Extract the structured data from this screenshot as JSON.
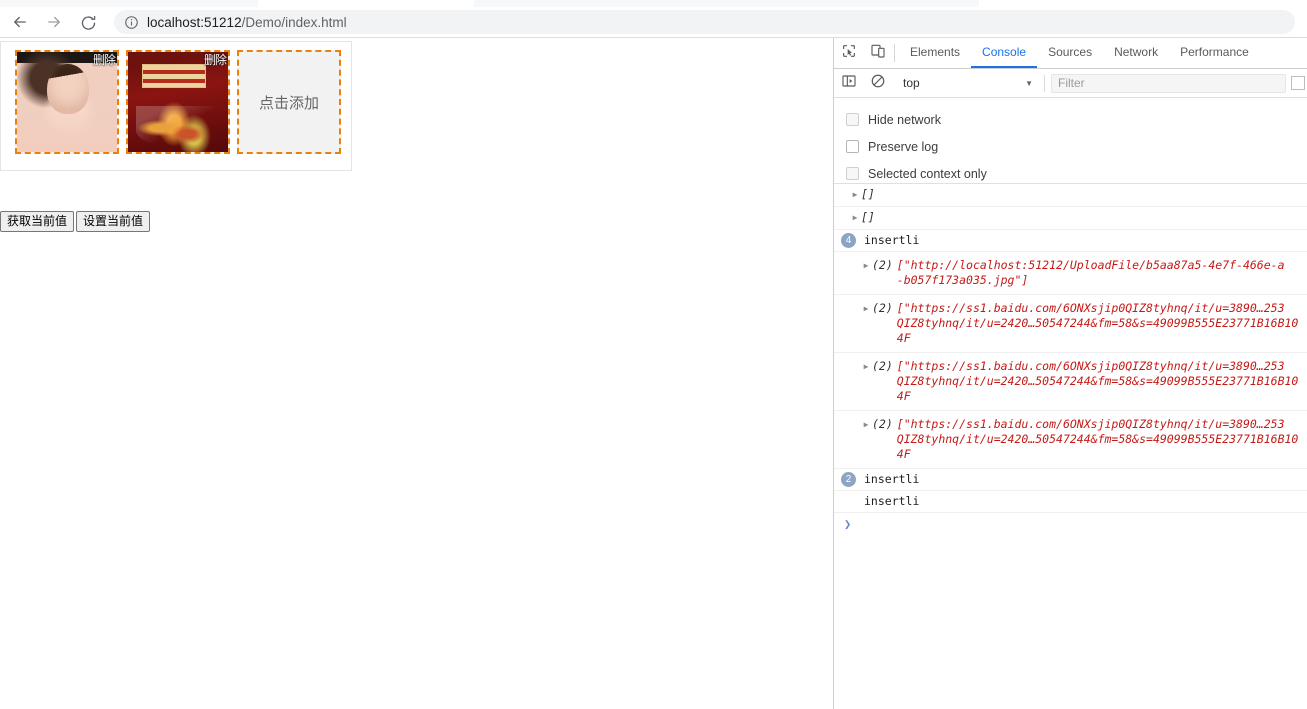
{
  "browser": {
    "back_icon": "back-arrow-icon",
    "forward_icon": "forward-arrow-icon",
    "reload_icon": "reload-icon",
    "info_icon": "info-circle-icon",
    "url_host": "localhost:51212",
    "url_path": "/Demo/index.html",
    "url_full": "localhost:51212/Demo/index.html"
  },
  "page": {
    "thumbnails": [
      {
        "alt": "portrait-photo",
        "delete_label": "删除"
      },
      {
        "alt": "food-poster-photo",
        "delete_label": "删除"
      }
    ],
    "add_label": "点击添加",
    "buttons": [
      {
        "label": "获取当前值"
      },
      {
        "label": "设置当前值"
      }
    ]
  },
  "devtools": {
    "inspect_icon": "inspect-element-icon",
    "device_icon": "device-toolbar-icon",
    "tabs": [
      {
        "label": "Elements",
        "active": false
      },
      {
        "label": "Console",
        "active": true
      },
      {
        "label": "Sources",
        "active": false
      },
      {
        "label": "Network",
        "active": false
      },
      {
        "label": "Performance",
        "active": false
      }
    ],
    "toolbar": {
      "sidebar_icon": "console-sidebar-icon",
      "clear_icon": "clear-console-icon",
      "context_value": "top",
      "caret": "▼",
      "filter_placeholder": "Filter",
      "level_icon": "log-levels-icon"
    },
    "options": [
      {
        "label": "Hide network",
        "checked": false
      },
      {
        "label": "Preserve log",
        "checked": false
      },
      {
        "label": "Selected context only",
        "checked": false
      }
    ],
    "logs": [
      {
        "kind": "expandable",
        "arrow": "▶",
        "text": "[]"
      },
      {
        "kind": "expandable",
        "arrow": "▶",
        "text": "[]"
      },
      {
        "kind": "badge",
        "count": "4",
        "text": "insertli"
      },
      {
        "kind": "array",
        "arrow": "▶",
        "count": "(2)",
        "text": "[\"http://localhost:51212/UploadFile/b5aa87a5-4e7f-466e-a\n-b057f173a035.jpg\"]"
      },
      {
        "kind": "array",
        "arrow": "▶",
        "count": "(2)",
        "text": "[\"https://ss1.baidu.com/6ONXsjip0QIZ8tyhnq/it/u=3890…253\nQIZ8tyhnq/it/u=2420…50547244&fm=58&s=49099B555E23771B16B104F"
      },
      {
        "kind": "array",
        "arrow": "▶",
        "count": "(2)",
        "text": "[\"https://ss1.baidu.com/6ONXsjip0QIZ8tyhnq/it/u=3890…253\nQIZ8tyhnq/it/u=2420…50547244&fm=58&s=49099B555E23771B16B104F"
      },
      {
        "kind": "array",
        "arrow": "▶",
        "count": "(2)",
        "text": "[\"https://ss1.baidu.com/6ONXsjip0QIZ8tyhnq/it/u=3890…253\nQIZ8tyhnq/it/u=2420…50547244&fm=58&s=49099B555E23771B16B104F"
      },
      {
        "kind": "badge",
        "count": "2",
        "text": "insertli"
      },
      {
        "kind": "plain",
        "text": "insertli"
      }
    ],
    "prompt_glyph": "❯"
  }
}
